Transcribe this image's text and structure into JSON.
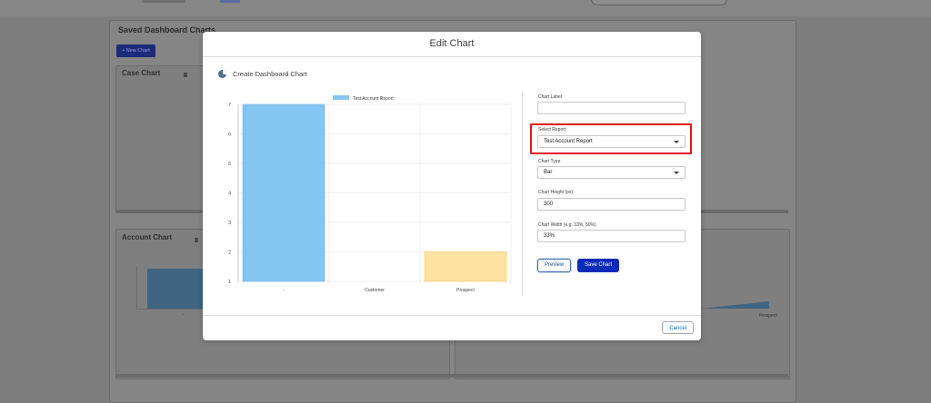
{
  "background": {
    "panel_title": "Saved Dashboard Charts",
    "new_chart_label": "+ New Chart",
    "card_case_title": "Case Chart",
    "card_account_title": "Account Chart",
    "mini_axis_labels": [
      "7",
      "6",
      "5",
      "4",
      "3",
      "2",
      "1"
    ],
    "mini_x_label": "-",
    "right_x_label": "Prospect"
  },
  "modal": {
    "title": "Edit Chart",
    "section_title": "Create Dashboard Chart",
    "cancel_label": "Cancel"
  },
  "form": {
    "chart_label": {
      "label": "Chart Label",
      "value": ""
    },
    "select_report": {
      "label": "Select Report",
      "value": "Test Account Report"
    },
    "chart_type": {
      "label": "Chart Type",
      "value": "Bar"
    },
    "chart_height": {
      "label": "Chart Height (px)",
      "value": "300"
    },
    "chart_width": {
      "label": "Chart Width (e.g. 33%, 50%)",
      "value": "33%"
    },
    "preview_label": "Preview",
    "save_label": "Save Chart"
  },
  "colors": {
    "bar_blue": "#85c6f1",
    "bar_yellow": "#fde39f",
    "highlight": "#e3171d",
    "save_button": "#0b2bb8"
  },
  "chart_data": {
    "type": "bar",
    "categories": [
      "-",
      "Customer",
      "Prospect"
    ],
    "series": [
      {
        "name": "Test Account Report",
        "values": [
          7,
          null,
          2
        ]
      }
    ],
    "bar_colors": [
      "#85c6f1",
      "#85c6f1",
      "#fde39f"
    ],
    "ylim": [
      1,
      7
    ],
    "yticks": [
      1,
      2,
      3,
      4,
      5,
      6,
      7
    ],
    "grid": true,
    "legend": "top-center"
  }
}
